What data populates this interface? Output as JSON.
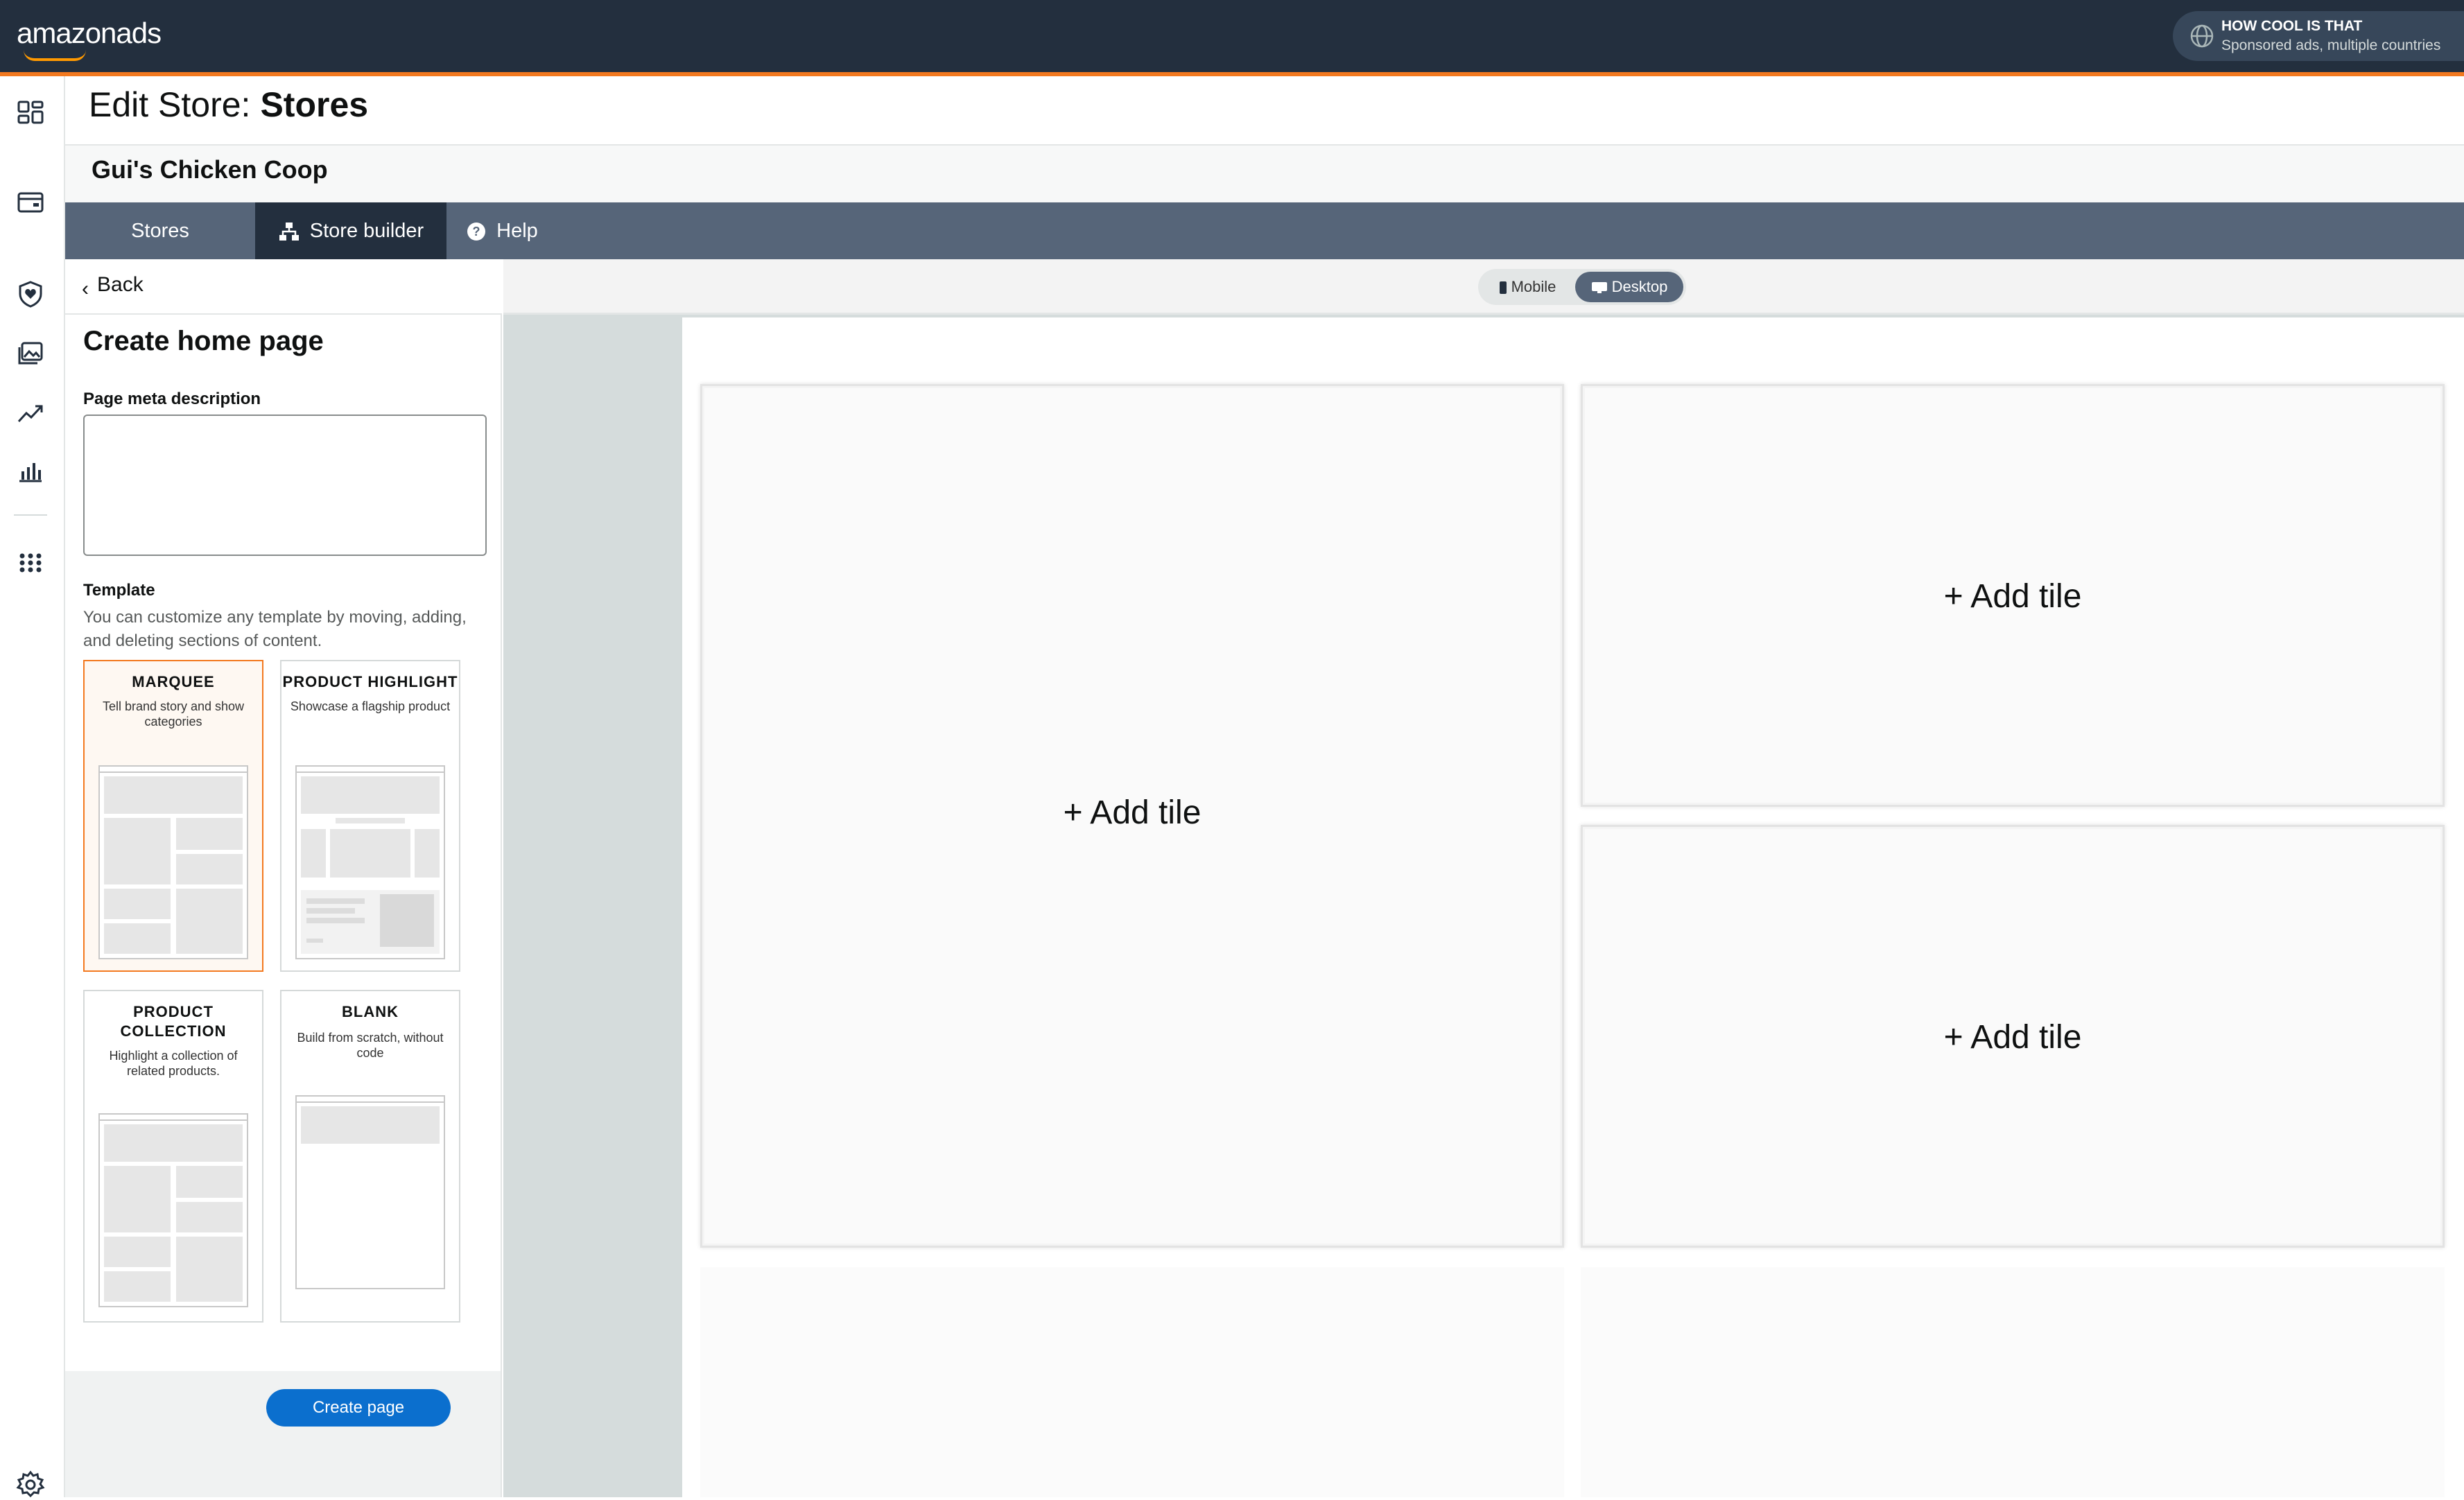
{
  "topbar": {
    "logo_prefix": "amazon",
    "logo_suffix": "ads",
    "account_name": "HOW COOL IS THAT",
    "account_subtitle": "Sponsored ads, multiple countries"
  },
  "leftnav": {
    "icons": [
      "dashboard-icon",
      "wallet-icon",
      "shield-heart-icon",
      "media-gallery-icon",
      "trending-up-icon",
      "bar-chart-icon",
      "apps-grid-icon",
      "settings-gear-icon"
    ]
  },
  "header": {
    "title_prefix": "Edit Store:",
    "title_store": "Stores",
    "store_name": "Gui's Chicken Coop"
  },
  "tabs": [
    {
      "label": "Stores",
      "icon": null
    },
    {
      "label": "Store builder",
      "icon": "sitemap-icon",
      "active": true
    },
    {
      "label": "Help",
      "icon": "help-circle-icon"
    }
  ],
  "panel": {
    "back_label": "Back",
    "heading": "Create home page",
    "meta_label": "Page meta description",
    "meta_value": "",
    "template_label": "Template",
    "template_help": "You can customize any template by moving, adding, and deleting sections of content.",
    "templates": [
      {
        "title": "MARQUEE",
        "desc": "Tell brand story and show categories",
        "selected": true
      },
      {
        "title": "PRODUCT HIGHLIGHT",
        "desc": "Showcase a flagship product"
      },
      {
        "title": "PRODUCT COLLECTION",
        "desc": "Highlight a collection of related products."
      },
      {
        "title": "BLANK",
        "desc": "Build from scratch, without code"
      }
    ],
    "create_button": "Create page"
  },
  "view_toggle": {
    "mobile_label": "Mobile",
    "desktop_label": "Desktop",
    "selected": "Desktop"
  },
  "canvas": {
    "tiles": [
      "+ Add tile",
      "+ Add tile",
      "+ Add tile"
    ]
  },
  "colors": {
    "topbar": "#232f3e",
    "accent": "#f3791f",
    "tabbar": "#566579",
    "primary_button": "#0b6fce"
  }
}
